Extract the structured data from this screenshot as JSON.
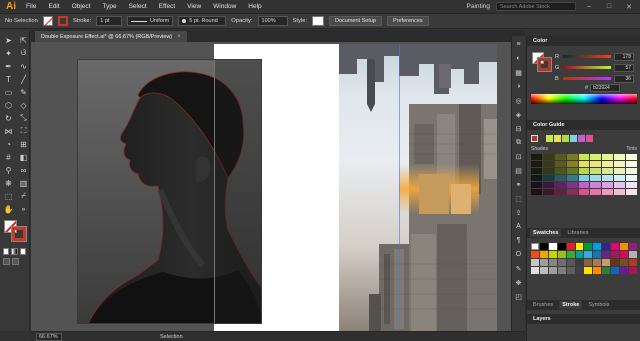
{
  "app": {
    "logo": "Ai",
    "menus": [
      "File",
      "Edit",
      "Object",
      "Type",
      "Select",
      "Effect",
      "View",
      "Window",
      "Help"
    ],
    "workspace": "Painting",
    "search_placeholder": "Search Adobe Stock"
  },
  "control_bar": {
    "selection_label": "No Selection",
    "stroke_label": "Stroke:",
    "stroke_weight": "1 pt",
    "profile": "Uniform",
    "brush": "5 pt. Round",
    "opacity_label": "Opacity:",
    "opacity_value": "100%",
    "style_label": "Style:",
    "document_setup": "Document Setup",
    "preferences": "Preferences"
  },
  "document": {
    "tab_title": "Double Exposure Effect.ai* @ 66.67% (RGB/Preview)",
    "close_glyph": "×"
  },
  "status_bar": {
    "zoom": "66.67%",
    "status_text": "Selection"
  },
  "color_panel": {
    "title": "Color",
    "sliders": [
      {
        "label": "R",
        "value": "178"
      },
      {
        "label": "G",
        "value": "57"
      },
      {
        "label": "B",
        "value": "36"
      }
    ],
    "hex_prefix": "#",
    "hex_value": "b23924"
  },
  "color_guide": {
    "title": "Color Guide",
    "shades_label": "Shades",
    "tints_label": "Tints"
  },
  "swatches_panel": {
    "tabs": [
      "Swatches",
      "Libraries"
    ]
  },
  "bottom_panel": {
    "tabs": [
      "Brushes",
      "Stroke",
      "Symbols"
    ]
  },
  "layers_panel": {
    "title": "Layers"
  },
  "colors": {
    "accent_stroke": "#b23924",
    "ai_logo": "#ff9a00"
  }
}
